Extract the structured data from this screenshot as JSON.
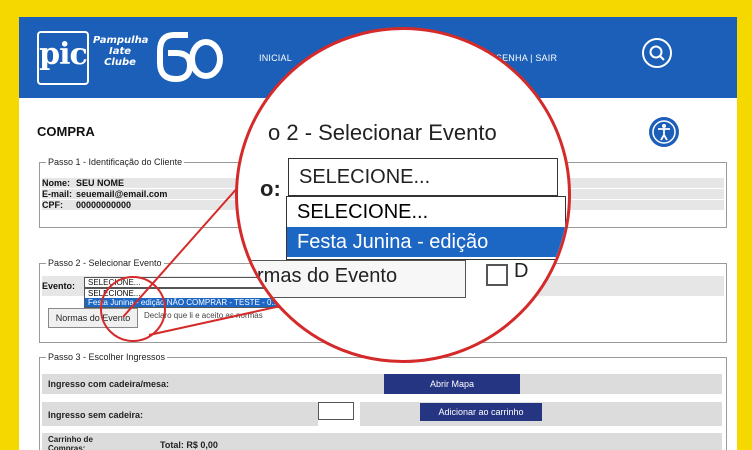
{
  "header": {
    "logo_text": "pic",
    "brand_line1": "Pampulha",
    "brand_line2": "Iate",
    "brand_line3": "Clube",
    "logo_number": "60",
    "nav_left": "INICIAL",
    "nav_right": "TROCAR SENHA  |  SAIR",
    "search_icon": "search-icon",
    "accent_color": "#1b5fb8",
    "frame_color": "#f4d800"
  },
  "page_title": "COMPRA",
  "step1": {
    "legend": "Passo 1 - Identificação do Cliente",
    "rows": [
      {
        "label": "Nome:",
        "value": "SEU NOME"
      },
      {
        "label": "E-mail:",
        "value": "seuemail@email.com"
      },
      {
        "label": "CPF:",
        "value": "00000000000"
      }
    ]
  },
  "step2": {
    "legend": "Passo 2 - Selecionar Evento",
    "evento_label": "Evento:",
    "select_value": "SELECIONE...",
    "options": [
      "SELECIONE...",
      "Festa Junina - edição NÃO COMPRAR - TESTE - 0..."
    ],
    "normas_button": "Normas do Evento",
    "agree_text": "Declaro que li e aceito as normas"
  },
  "step3": {
    "legend": "Passo 3 - Escolher Ingressos",
    "row1_label": "Ingresso com cadeira/mesa:",
    "row1_button": "Abrir Mapa",
    "row2_label": "Ingresso sem cadeira:",
    "row2_button": "Adicionar ao carrinho",
    "cart_label": "Carrinho de Compras:",
    "total": "Total: R$ 0,00"
  },
  "magnifier": {
    "title": "o 2 - Selecionar Evento",
    "label_fragment": "o:",
    "select_value": "SELECIONE...",
    "option1": "SELECIONE...",
    "option2": "Festa Junina - edição",
    "normas_fragment": "rmas do Evento",
    "agree_fragment": "D"
  }
}
